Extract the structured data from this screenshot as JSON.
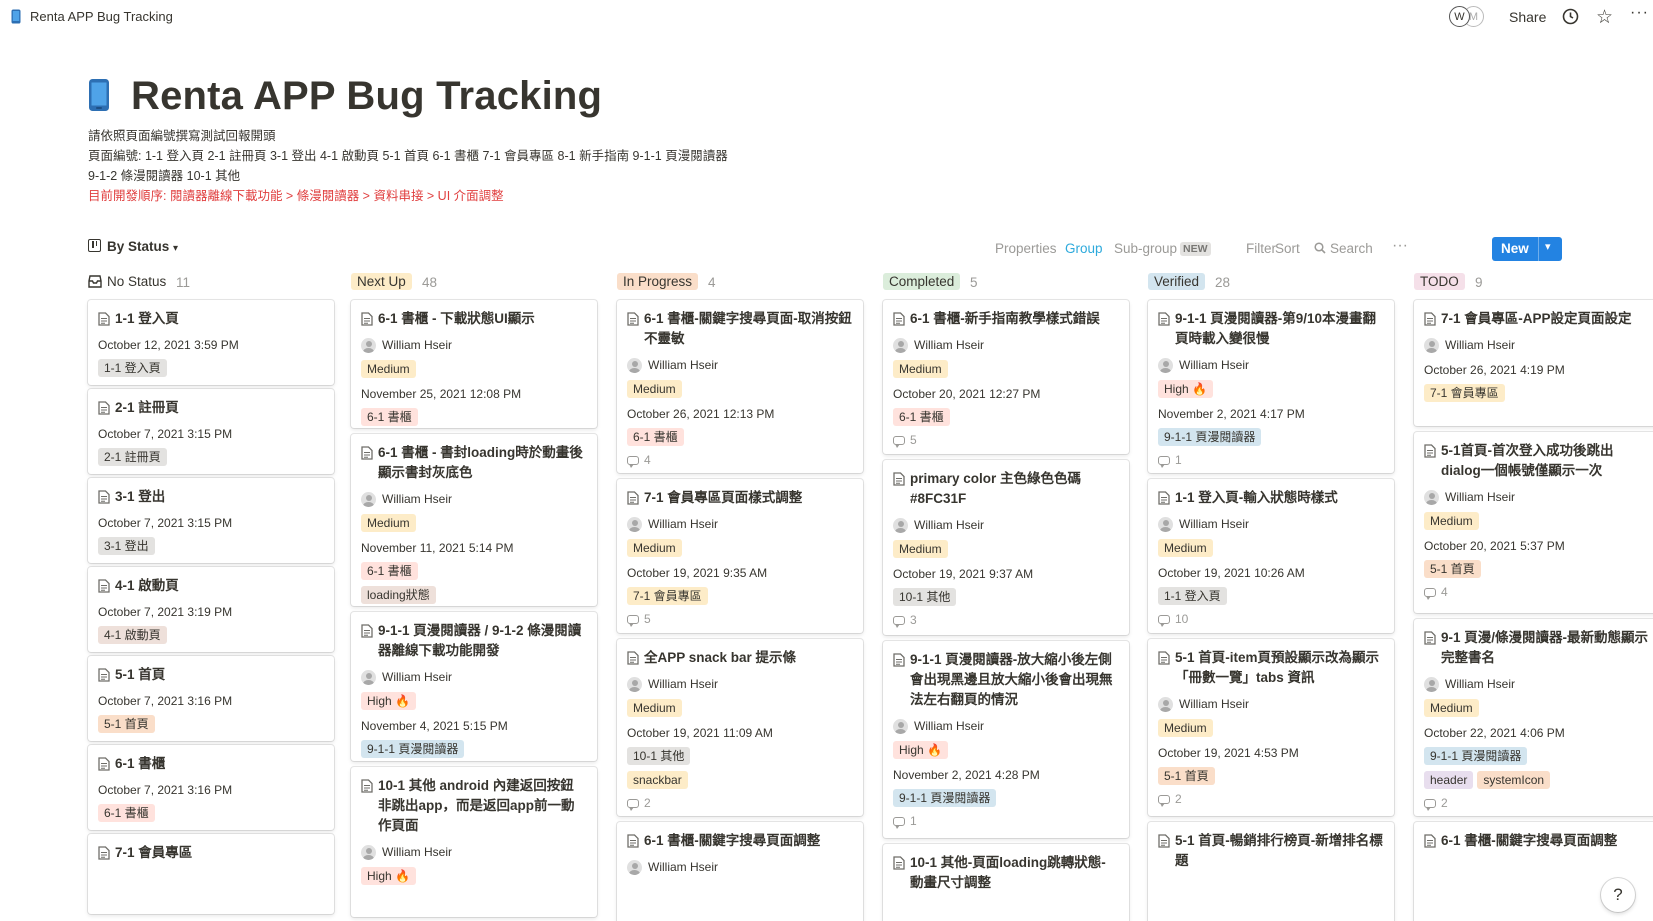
{
  "topbar": {
    "breadcrumb": "Renta APP Bug Tracking",
    "avatar_w": "W",
    "avatar_m": "M",
    "share": "Share",
    "more": "···"
  },
  "page": {
    "title": "Renta APP Bug Tracking",
    "desc1": "請依照頁面編號撰寫測試回報開頭",
    "desc2": "頁面編號:  1-1 登入頁   2-1 註冊頁  3-1 登出  4-1 啟動頁  5-1 首頁  6-1 書櫃  7-1 會員專區  8-1 新手指南  9-1-1 頁漫閱讀器",
    "desc3": "9-1-2 條漫閱讀器  10-1 其他",
    "desc4": "目前開發順序: 閱讀器離線下載功能 > 條漫閱讀器 > 資料串接 > UI 介面調整"
  },
  "viewbar": {
    "view_name": "By Status",
    "properties": "Properties",
    "group": "Group",
    "subgroup": "Sub-group",
    "new_badge": "NEW",
    "filter": "Filter",
    "sort": "Sort",
    "search": "Search",
    "more": "···",
    "new_button": "New"
  },
  "colors": {
    "accent": "#2383e2",
    "red_text": "#e03e3e",
    "tag_gray": "#e3e2e0",
    "tag_brown": "#eee0da",
    "tag_orange": "#fadec9",
    "tag_yellow": "#fdecc8",
    "tag_green": "#dbeddb",
    "tag_blue": "#d3e5ef",
    "tag_purple": "#e8deee",
    "tag_pink": "#f5e0e9",
    "tag_red": "#ffe2dd"
  },
  "columns": [
    {
      "name": "No Status",
      "count": "11",
      "color": "none",
      "cards": [
        {
          "title": "1-1 登入頁",
          "date": "October 12, 2021 3:59 PM",
          "tags": [
            {
              "label": "1-1 登入頁",
              "color": "gray"
            }
          ]
        },
        {
          "title": "2-1 註冊頁",
          "date": "October 7, 2021 3:15 PM",
          "tags": [
            {
              "label": "2-1 註冊頁",
              "color": "gray"
            }
          ]
        },
        {
          "title": "3-1 登出",
          "date": "October 7, 2021 3:15 PM",
          "tags": [
            {
              "label": "3-1 登出",
              "color": "gray"
            }
          ]
        },
        {
          "title": "4-1 啟動頁",
          "date": "October 7, 2021 3:19 PM",
          "tags": [
            {
              "label": "4-1 啟動頁",
              "color": "brown"
            }
          ]
        },
        {
          "title": "5-1 首頁",
          "date": "October 7, 2021 3:16 PM",
          "tags": [
            {
              "label": "5-1 首頁",
              "color": "orange"
            }
          ]
        },
        {
          "title": "6-1 書櫃",
          "date": "October 7, 2021 3:16 PM",
          "tags": [
            {
              "label": "6-1 書櫃",
              "color": "red"
            }
          ]
        },
        {
          "title": "7-1 會員專區",
          "date": "",
          "tags": []
        }
      ]
    },
    {
      "name": "Next Up",
      "count": "48",
      "color": "yellow",
      "cards": [
        {
          "title": "6-1 書櫃 - 下載狀態UI顯示",
          "person": "William Hseir",
          "priority": "Medium",
          "date": "November 25, 2021 12:08 PM",
          "tags": [
            {
              "label": "6-1 書櫃",
              "color": "red"
            }
          ]
        },
        {
          "title": "6-1 書櫃 - 書封loading時於動畫後顯示書封灰底色",
          "person": "William Hseir",
          "priority": "Medium",
          "date": "November 11, 2021 5:14 PM",
          "tags": [
            {
              "label": "6-1 書櫃",
              "color": "red"
            }
          ],
          "tags2": [
            {
              "label": "loading狀態",
              "color": "brown"
            }
          ]
        },
        {
          "title": "9-1-1 頁漫閱讀器 / 9-1-2 條漫閱讀器離線下載功能開發",
          "person": "William Hseir",
          "priority": "High 🔥",
          "date": "November 4, 2021 5:15 PM",
          "tags": [
            {
              "label": "9-1-1 頁漫閱讀器",
              "color": "blue"
            }
          ]
        },
        {
          "title": "10-1 其他 android 內建返回按鈕非跳出app，而是返回app前一動作頁面",
          "person": "William Hseir",
          "priority": "High 🔥",
          "date": "",
          "tags": []
        }
      ]
    },
    {
      "name": "In Progress",
      "count": "4",
      "color": "orange",
      "cards": [
        {
          "title": "6-1 書櫃-關鍵字搜尋頁面-取消按鈕不靈敏",
          "person": "William Hseir",
          "priority": "Medium",
          "date": "October 26, 2021 12:13 PM",
          "tags": [
            {
              "label": "6-1 書櫃",
              "color": "red"
            }
          ],
          "comments": "4"
        },
        {
          "title": "7-1 會員專區頁面樣式調整",
          "person": "William Hseir",
          "priority": "Medium",
          "date": "October 19, 2021 9:35 AM",
          "tags": [
            {
              "label": "7-1 會員專區",
              "color": "yellow"
            }
          ],
          "comments": "5"
        },
        {
          "title": "全APP snack bar 提示條",
          "person": "William Hseir",
          "priority": "Medium",
          "date": "October 19, 2021 11:09 AM",
          "tags": [
            {
              "label": "10-1 其他",
              "color": "gray"
            }
          ],
          "tags2": [
            {
              "label": "snackbar",
              "color": "yellow"
            }
          ],
          "comments": "2"
        },
        {
          "title": "6-1 書櫃-關鍵字搜尋頁面調整",
          "person": "William Hseir",
          "priority": "",
          "date": "",
          "tags": []
        }
      ]
    },
    {
      "name": "Completed",
      "count": "5",
      "color": "green",
      "cards": [
        {
          "title": "6-1 書櫃-新手指南教學樣式錯誤",
          "person": "William Hseir",
          "priority": "Medium",
          "date": "October 20, 2021 12:27 PM",
          "tags": [
            {
              "label": "6-1 書櫃",
              "color": "red"
            }
          ],
          "comments": "5"
        },
        {
          "title": "primary color 主色綠色色碼 #8FC31F",
          "person": "William Hseir",
          "priority": "Medium",
          "date": "October 19, 2021 9:37 AM",
          "tags": [
            {
              "label": "10-1 其他",
              "color": "gray"
            }
          ],
          "comments": "3"
        },
        {
          "title": "9-1-1 頁漫閱讀器-放大縮小後左側會出現黑邊且放大縮小後會出現無法左右翻頁的情況",
          "person": "William Hseir",
          "priority": "High 🔥",
          "date": "November 2, 2021 4:28 PM",
          "tags": [
            {
              "label": "9-1-1 頁漫閱讀器",
              "color": "blue"
            }
          ],
          "comments": "1"
        },
        {
          "title": "10-1 其他-頁面loading跳轉狀態-動畫尺寸調整",
          "person": "",
          "priority": "",
          "date": "",
          "tags": []
        }
      ]
    },
    {
      "name": "Verified",
      "count": "28",
      "color": "blue",
      "cards": [
        {
          "title": "9-1-1 頁漫閱讀器-第9/10本漫畫翻頁時載入變很慢",
          "person": "William Hseir",
          "priority": "High 🔥",
          "date": "November 2, 2021 4:17 PM",
          "tags": [
            {
              "label": "9-1-1 頁漫閱讀器",
              "color": "blue"
            }
          ],
          "comments": "1"
        },
        {
          "title": "1-1 登入頁-輸入狀態時樣式",
          "person": "William Hseir",
          "priority": "Medium",
          "date": "October 19, 2021 10:26 AM",
          "tags": [
            {
              "label": "1-1 登入頁",
              "color": "gray"
            }
          ],
          "comments": "10"
        },
        {
          "title": "5-1 首頁-item頁預設顯示改為顯示「冊數一覽」tabs 資訊",
          "person": "William Hseir",
          "priority": "Medium",
          "date": "October 19, 2021 4:53 PM",
          "tags": [
            {
              "label": "5-1 首頁",
              "color": "orange"
            }
          ],
          "comments": "2"
        },
        {
          "title": "5-1 首頁-暢銷排行榜頁-新增排名標題",
          "person": "",
          "priority": "",
          "date": "",
          "tags": []
        }
      ]
    },
    {
      "name": "TODO",
      "count": "9",
      "color": "pink",
      "cards": [
        {
          "title": "7-1 會員專區-APP設定頁面設定",
          "person": "William Hseir",
          "priority": "",
          "date": "October 26, 2021 4:19 PM",
          "tags": [
            {
              "label": "7-1 會員專區",
              "color": "yellow"
            }
          ]
        },
        {
          "title": "5-1首頁-首次登入成功後跳出dialog一個帳號僅顯示一次",
          "person": "William Hseir",
          "priority": "Medium",
          "date": "October 20, 2021 5:37 PM",
          "tags": [
            {
              "label": "5-1 首頁",
              "color": "orange"
            }
          ],
          "comments": "4"
        },
        {
          "title": "9-1 頁漫/條漫閱讀器-最新動態顯示完整書名",
          "person": "William Hseir",
          "priority": "Medium",
          "date": "October 22, 2021 4:06 PM",
          "tags": [
            {
              "label": "9-1-1 頁漫閱讀器",
              "color": "blue"
            }
          ],
          "tags2": [
            {
              "label": "header",
              "color": "purple"
            },
            {
              "label": "systemIcon",
              "color": "orange"
            }
          ],
          "comments": "2"
        },
        {
          "title": "6-1 書櫃-關鍵字搜尋頁面調整",
          "person": "",
          "priority": "",
          "date": "",
          "tags": []
        }
      ]
    }
  ],
  "help": "?"
}
